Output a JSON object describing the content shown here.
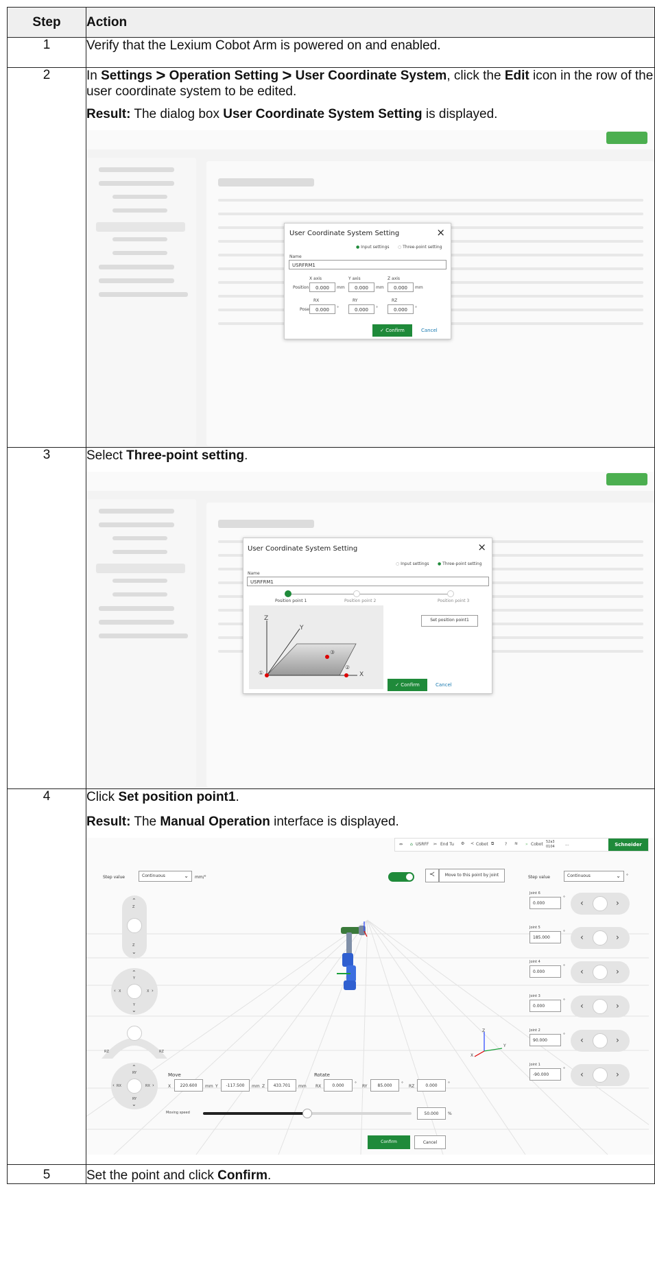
{
  "headers": {
    "step": "Step",
    "action": "Action"
  },
  "rows": [
    {
      "step": "1",
      "text": "Verify that the Lexium Cobot Arm is powered on and enabled."
    },
    {
      "step": "2",
      "pre": "In ",
      "b1": "Settings",
      "gt": ">",
      "b2": "Operation Setting",
      "b3": "User Coordinate System",
      "mid": ", click the ",
      "b4": "Edit",
      "post": " icon in the row of the user coordinate system to be edited.",
      "result_label": "Result:",
      "result_pre": " The dialog box ",
      "result_b": "User Coordinate System Setting",
      "result_post": " is displayed."
    },
    {
      "step": "3",
      "pre": "Select ",
      "b": "Three-point setting",
      "post": "."
    },
    {
      "step": "4",
      "pre": "Click ",
      "b": "Set position point1",
      "post": ".",
      "result_label": "Result:",
      "result_pre": " The ",
      "result_b": "Manual Operation",
      "result_post": " interface is displayed."
    },
    {
      "step": "5",
      "pre": "Set the point and click ",
      "b": "Confirm",
      "post": "."
    }
  ],
  "dialog1": {
    "title": "User Coordinate System Setting",
    "close": "×",
    "opt1": "Input settings",
    "opt2": "Three-point setting",
    "name_label": "Name",
    "name_value": "USRFRM1",
    "x_axis": "X axis",
    "y_axis": "Y axis",
    "z_axis": "Z axis",
    "position": "Position",
    "pose": "Pose",
    "val": "0.000",
    "mm": "mm",
    "deg": "°",
    "rx": "RX",
    "ry": "RY",
    "rz": "RZ",
    "confirm": "✓ Confirm",
    "cancel": "Cancel"
  },
  "dialog2": {
    "title": "User Coordinate System Setting",
    "close": "×",
    "opt1": "Input settings",
    "opt2": "Three-point setting",
    "name_label": "Name",
    "name_value": "USRFRM1",
    "p1": "Position point 1",
    "p2": "Position point 2",
    "p3": "Position point 3",
    "set_btn": "Set position point1",
    "axis_z": "Z",
    "axis_y": "Y",
    "axis_x": "X",
    "m1": "①",
    "m2": "②",
    "m3": "③",
    "confirm": "✓ Confirm",
    "cancel": "Cancel"
  },
  "manual": {
    "top": {
      "frame": "USRFF",
      "tool": "End Tu",
      "cobot": "Cobot",
      "speed": "Cobot",
      "code": "52a3 0104",
      "more": "...",
      "brand": "Schneider",
      "help": "?"
    },
    "step_label": "Step value",
    "step_value": "Continuous",
    "unit": "mm/°",
    "move_btn": "Move to this point by joint",
    "move_label": "Move",
    "rotate_label": "Rotate",
    "x": "X",
    "y": "Y",
    "z": "Z",
    "rx": "RX",
    "ry": "RY",
    "rz": "RZ",
    "x_val": "220.600",
    "y_val": "-117.500",
    "z_val": "433.701",
    "rx_val": "0.000",
    "ry_val": "85.000",
    "rz_val": "0.000",
    "mm": "mm",
    "deg": "°",
    "speed_label": "Moving speed",
    "speed_val": "50.000",
    "pct": "%",
    "speed_fraction": 0.5,
    "confirm": "Confirm",
    "cancel": "Cancel",
    "joints": [
      {
        "label": "Joint 6",
        "value": "0.000"
      },
      {
        "label": "Joint 5",
        "value": "185.000"
      },
      {
        "label": "Joint 4",
        "value": "0.000"
      },
      {
        "label": "Joint 3",
        "value": "0.000"
      },
      {
        "label": "Joint 2",
        "value": "90.000"
      },
      {
        "label": "Joint 1",
        "value": "-90.000"
      }
    ]
  }
}
